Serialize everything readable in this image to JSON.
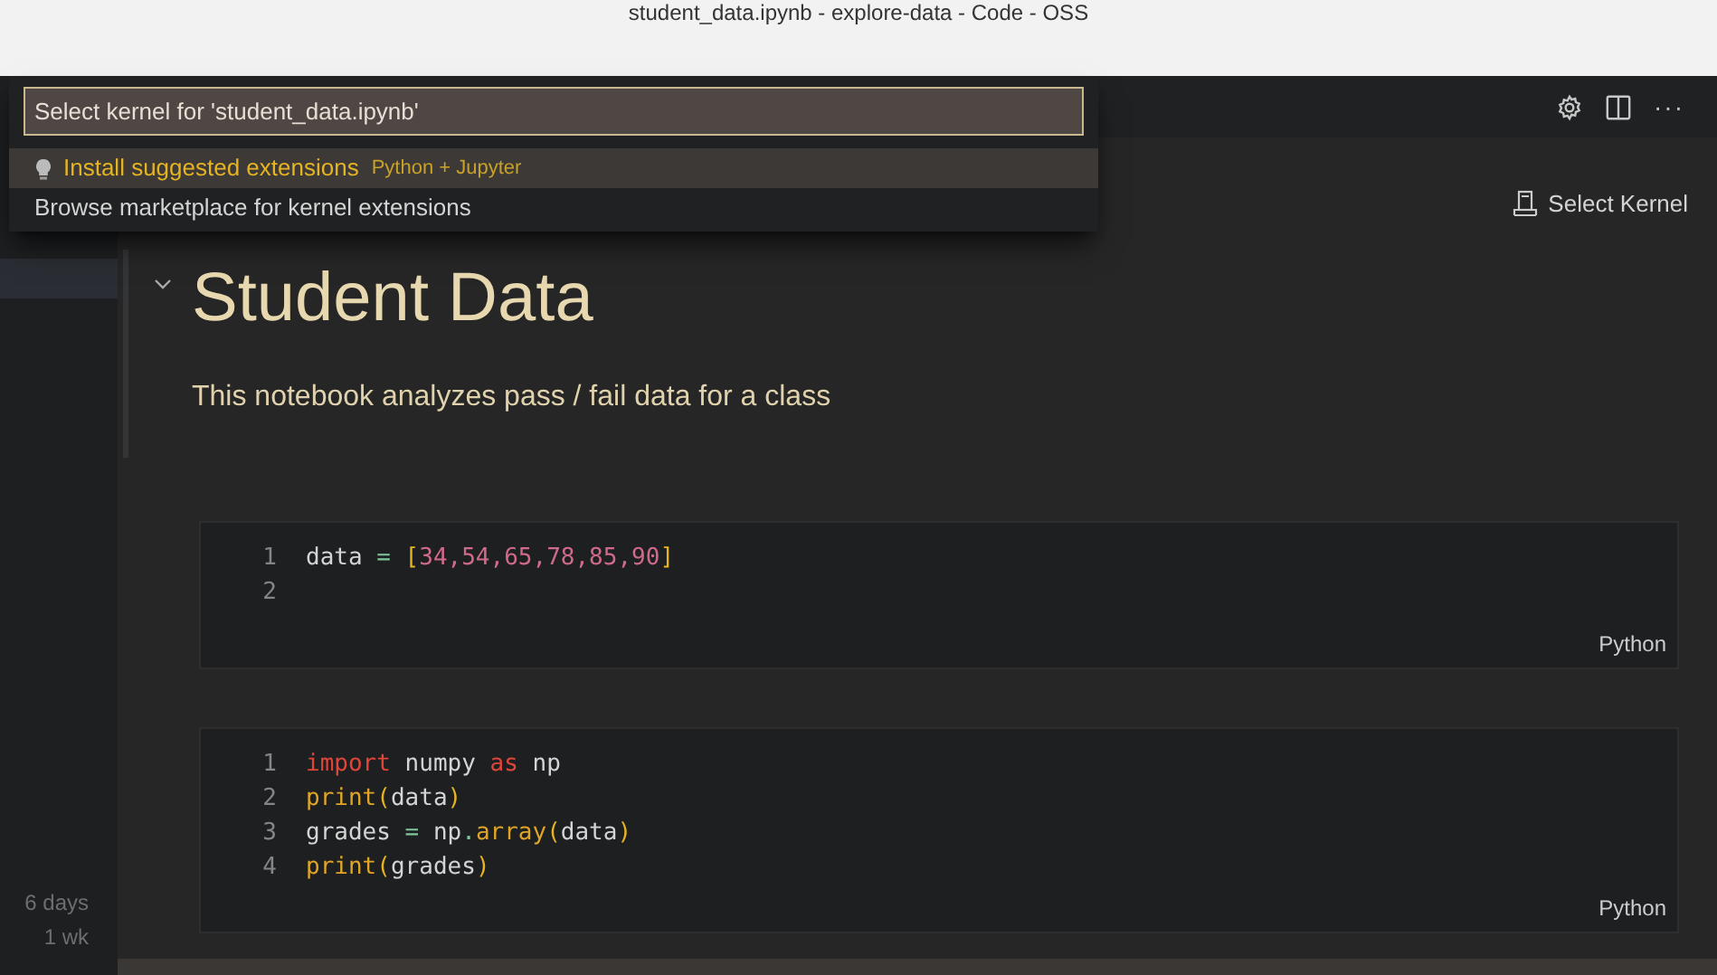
{
  "window": {
    "title": "student_data.ipynb - explore-data - Code - OSS"
  },
  "quick_pick": {
    "value": "Select kernel for 'student_data.ipynb'",
    "items": [
      {
        "label": "Install suggested extensions",
        "detail": "Python + Jupyter",
        "selected": true
      },
      {
        "label": "Browse marketplace for kernel extensions",
        "selected": false
      }
    ]
  },
  "toolbar": {
    "more_button": "···",
    "kernel_button": "Select Kernel"
  },
  "sidebar": {
    "times": [
      "6 days",
      "1 wk"
    ]
  },
  "markdown_cell": {
    "heading": "Student Data",
    "text": "This notebook analyzes pass / fail data for a class"
  },
  "code_cells": [
    {
      "language": "Python",
      "lines": [
        {
          "number": "1",
          "tokens": [
            {
              "text": "data ",
              "kind": "plain"
            },
            {
              "text": "=",
              "kind": "operator"
            },
            {
              "text": " [",
              "kind": "bracket"
            },
            {
              "text": "34,54,65,78,85,90",
              "kind": "number"
            },
            {
              "text": "]",
              "kind": "bracket"
            }
          ]
        },
        {
          "number": "2"
        }
      ]
    },
    {
      "language": "Python",
      "lines": [
        {
          "number": "1",
          "tokens": [
            {
              "text": "import",
              "kind": "keyword"
            },
            {
              "text": " numpy ",
              "kind": "plain"
            },
            {
              "text": "as",
              "kind": "keyword"
            },
            {
              "text": " np",
              "kind": "plain"
            }
          ]
        },
        {
          "number": "2",
          "tokens": [
            {
              "text": "print",
              "kind": "function"
            },
            {
              "text": "(",
              "kind": "bracket"
            },
            {
              "text": "data",
              "kind": "plain"
            },
            {
              "text": ")",
              "kind": "bracket"
            }
          ]
        },
        {
          "number": "3",
          "tokens": [
            {
              "text": "grades ",
              "kind": "plain"
            },
            {
              "text": "=",
              "kind": "operator"
            },
            {
              "text": " np",
              "kind": "plain"
            },
            {
              "text": ".",
              "kind": "operator"
            },
            {
              "text": "array",
              "kind": "function"
            },
            {
              "text": "(",
              "kind": "bracket"
            },
            {
              "text": "data",
              "kind": "plain"
            },
            {
              "text": ")",
              "kind": "bracket"
            }
          ]
        },
        {
          "number": "4",
          "tokens": [
            {
              "text": "print",
              "kind": "function"
            },
            {
              "text": "(",
              "kind": "bracket"
            },
            {
              "text": "grades",
              "kind": "plain"
            },
            {
              "text": ")",
              "kind": "bracket"
            }
          ]
        }
      ]
    }
  ]
}
